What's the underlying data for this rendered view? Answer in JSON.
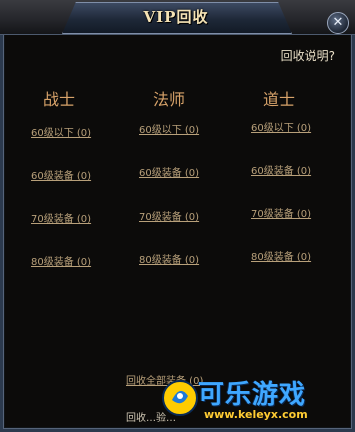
{
  "window": {
    "title": "VIP回收",
    "close_glyph": "✕",
    "help_link": "回收说明?"
  },
  "columns": [
    {
      "header": "战士",
      "items": [
        "60级以下 (0)",
        "60级装备 (0)",
        "70级装备 (0)",
        "80级装备 (0)"
      ]
    },
    {
      "header": "法师",
      "items": [
        "60级以下 (0)",
        "60级装备 (0)",
        "70级装备 (0)",
        "80级装备 (0)"
      ]
    },
    {
      "header": "道士",
      "items": [
        "60级以下 (0)",
        "60级装备 (0)",
        "70级装备 (0)",
        "80级装备 (0)"
      ]
    }
  ],
  "footer": {
    "recycle_all": "回收全部装备 (0)",
    "recycle_partial": "回收…验…"
  },
  "watermark": {
    "brand": "可乐游戏",
    "url": "www.keleyx.com"
  },
  "colors": {
    "header": "#d8a36a",
    "item_link": "#b8a07a",
    "watermark_blue": "#3fa7ff",
    "watermark_url": "#ffcc33"
  }
}
